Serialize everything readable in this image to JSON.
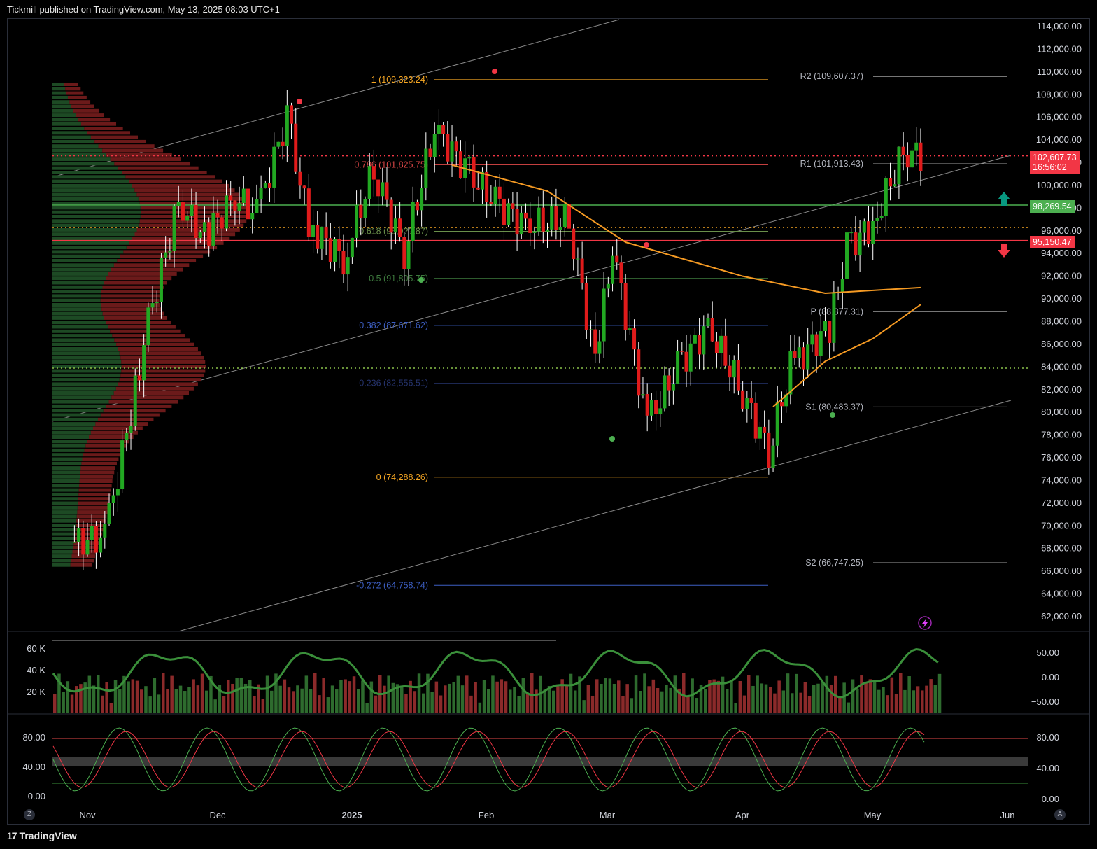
{
  "header": {
    "text": "Tickmill published on TradingView.com, May 13, 2025 08:03 UTC+1"
  },
  "footer": {
    "brand": "TradingView",
    "logo_glyph": "17"
  },
  "price_axis": {
    "ticks": [
      "114,000.00",
      "112,000.00",
      "110,000.00",
      "108,000.00",
      "106,000.00",
      "104,000.00",
      "102,000.00",
      "100,000.00",
      "98,000.00",
      "96,000.00",
      "94,000.00",
      "92,000.00",
      "90,000.00",
      "88,000.00",
      "86,000.00",
      "84,000.00",
      "82,000.00",
      "80,000.00",
      "78,000.00",
      "76,000.00",
      "74,000.00",
      "72,000.00",
      "70,000.00",
      "68,000.00",
      "66,000.00",
      "64,000.00",
      "62,000.00"
    ],
    "current_price": "102,607.73",
    "countdown": "16:56:02",
    "level_green": "98,269.54",
    "level_red": "95,150.47"
  },
  "time_axis": {
    "labels": [
      "Nov",
      "Dec",
      "2025",
      "Feb",
      "Mar",
      "Apr",
      "May",
      "Jun"
    ]
  },
  "corner_buttons": {
    "left": "Z",
    "right": "A"
  },
  "fib_labels": [
    {
      "text": "1 (109,323.24)",
      "color": "#f5a623"
    },
    {
      "text": "0.786 (101,825.75)",
      "color": "#e04848"
    },
    {
      "text": "0.618 (95,9??.87)",
      "color": "#6a8f4a"
    },
    {
      "text": "0.5 (91,805.75)",
      "color": "#3d7a3d"
    },
    {
      "text": "0.382 (87,671.62)",
      "color": "#3d5fc4"
    },
    {
      "text": "0.236 (82,556.51)",
      "color": "#26346e"
    },
    {
      "text": "0 (74,288.26)",
      "color": "#f5a623"
    },
    {
      "text": "-0.272 (64,758.74)",
      "color": "#3d5fc4"
    }
  ],
  "pivot_labels": [
    {
      "text": "R2 (109,607.37)"
    },
    {
      "text": "R1 (101,913.43)"
    },
    {
      "text": "P (88,877.31)"
    },
    {
      "text": "S1 (80,483.37)"
    },
    {
      "text": "S2 (66,747.25)"
    }
  ],
  "volume_panel": {
    "left_ticks": [
      "60 K",
      "40 K",
      "20 K"
    ],
    "right_ticks": [
      "50.00",
      "0.00",
      "−50.00"
    ]
  },
  "stoch_panel": {
    "left_ticks": [
      "80.00",
      "40.00",
      "0.00"
    ],
    "right_ticks": [
      "80.00",
      "40.00",
      "0.00"
    ]
  },
  "chart_data": {
    "type": "candlestick",
    "title": "",
    "ylim": [
      61000,
      115000
    ],
    "x_range": [
      "Oct 2024",
      "Jun 2025"
    ],
    "candles_close_path": [
      {
        "x": "Oct 28",
        "y": 68500
      },
      {
        "x": "Nov 5",
        "y": 69000
      },
      {
        "x": "Nov 11",
        "y": 80000
      },
      {
        "x": "Nov 15",
        "y": 88000
      },
      {
        "x": "Nov 22",
        "y": 98500
      },
      {
        "x": "Nov 28",
        "y": 95500
      },
      {
        "x": "Dec 5",
        "y": 99000
      },
      {
        "x": "Dec 10",
        "y": 97500
      },
      {
        "x": "Dec 17",
        "y": 106000
      },
      {
        "x": "Dec 22",
        "y": 96500
      },
      {
        "x": "Dec 30",
        "y": 93500
      },
      {
        "x": "Jan 6",
        "y": 101500
      },
      {
        "x": "Jan 13",
        "y": 94000
      },
      {
        "x": "Jan 20",
        "y": 105000
      },
      {
        "x": "Jan 27",
        "y": 101500
      },
      {
        "x": "Feb 3",
        "y": 98500
      },
      {
        "x": "Feb 10",
        "y": 96500
      },
      {
        "x": "Feb 20",
        "y": 97000
      },
      {
        "x": "Feb 26",
        "y": 84500
      },
      {
        "x": "Mar 2",
        "y": 94500
      },
      {
        "x": "Mar 10",
        "y": 79000
      },
      {
        "x": "Mar 17",
        "y": 84000
      },
      {
        "x": "Mar 24",
        "y": 87500
      },
      {
        "x": "Mar 31",
        "y": 82500
      },
      {
        "x": "Apr 7",
        "y": 76500
      },
      {
        "x": "Apr 12",
        "y": 84000
      },
      {
        "x": "Apr 21",
        "y": 87500
      },
      {
        "x": "Apr 25",
        "y": 94500
      },
      {
        "x": "May 1",
        "y": 96500
      },
      {
        "x": "May 8",
        "y": 103000
      },
      {
        "x": "May 12",
        "y": 102608
      }
    ],
    "moving_averages": [
      {
        "color": "#f59a23",
        "points": [
          {
            "x": "Jan 24",
            "y": 101800
          },
          {
            "x": "Feb 15",
            "y": 99500
          },
          {
            "x": "Mar 5",
            "y": 95000
          },
          {
            "x": "Apr 1",
            "y": 92000
          },
          {
            "x": "Apr 20",
            "y": 90500
          },
          {
            "x": "May 12",
            "y": 91000
          }
        ]
      },
      {
        "color": "#f59a23",
        "points": [
          {
            "x": "Apr 8",
            "y": 80500
          },
          {
            "x": "Apr 20",
            "y": 84500
          },
          {
            "x": "May 1",
            "y": 86500
          },
          {
            "x": "May 12",
            "y": 89500
          }
        ]
      }
    ],
    "horizontal_levels": [
      {
        "value": 98269.54,
        "color": "#4caf50"
      },
      {
        "value": 95150.47,
        "color": "#f23645"
      },
      {
        "value": 102607.73,
        "color": "#f23645"
      },
      {
        "value": 96300,
        "color": "#f5a623"
      },
      {
        "value": 83900,
        "color": "#8bc34a"
      }
    ],
    "grid": false,
    "legend": "none"
  }
}
